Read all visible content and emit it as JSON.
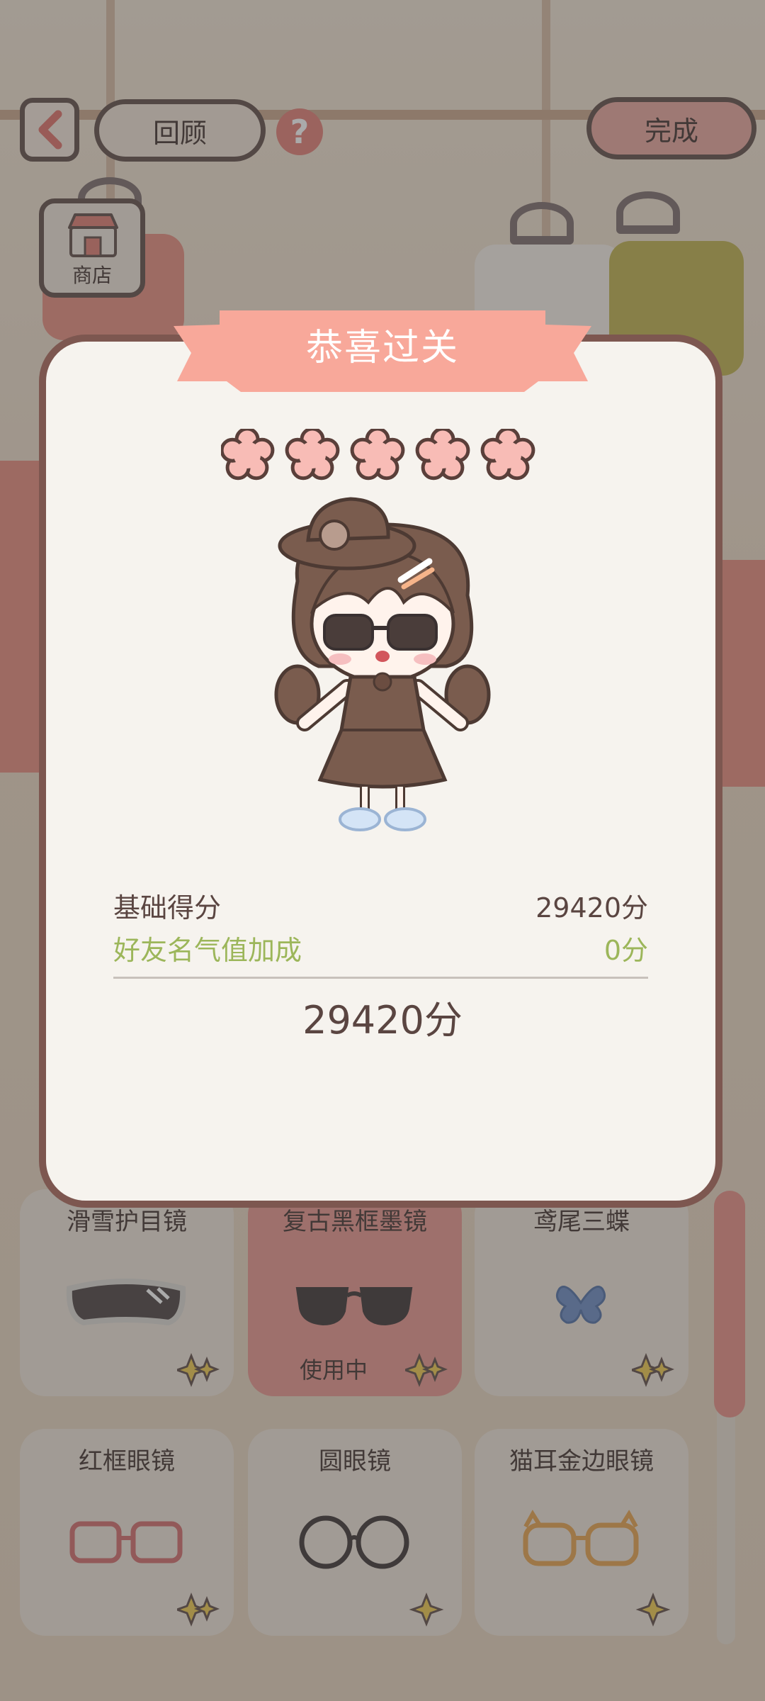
{
  "top_bar": {
    "review_label": "回顾",
    "help_label": "?",
    "done_label": "完成"
  },
  "shop": {
    "label": "商店"
  },
  "modal": {
    "title": "恭喜过关",
    "star_count": 5,
    "score_rows": [
      {
        "label": "基础得分",
        "value": "29420分"
      },
      {
        "label": "好友名气值加成",
        "value": "0分"
      }
    ],
    "total": "29420分"
  },
  "items": [
    {
      "name": "滑雪护目镜",
      "in_use": ""
    },
    {
      "name": "复古黑框墨镜",
      "in_use": "使用中"
    },
    {
      "name": "鸢尾三蝶",
      "in_use": ""
    },
    {
      "name": "红框眼镜",
      "in_use": ""
    },
    {
      "name": "圆眼镜",
      "in_use": ""
    },
    {
      "name": "猫耳金边眼镜",
      "in_use": ""
    }
  ],
  "colors": {
    "accent": "#f4a898",
    "bonus_green": "#9cb65a",
    "modal_border": "#7d5750"
  }
}
